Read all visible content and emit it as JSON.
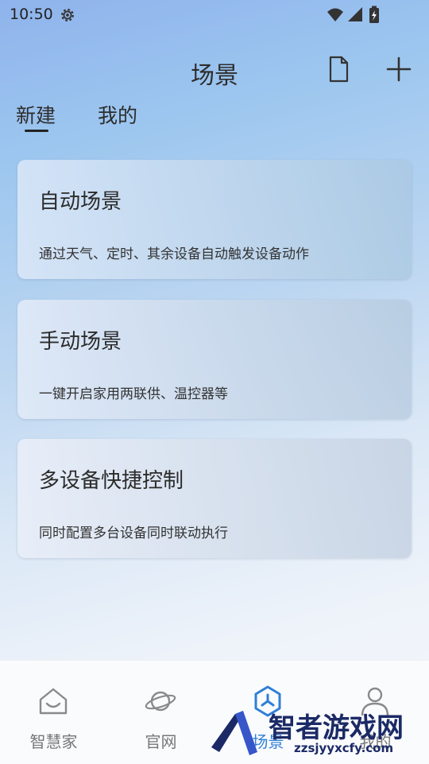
{
  "status_bar": {
    "time": "10:50",
    "icons": [
      "gear-icon",
      "wifi-icon",
      "signal-icon",
      "battery-icon"
    ]
  },
  "header": {
    "title": "场景",
    "actions": [
      "document-icon",
      "plus-icon"
    ]
  },
  "tabs": [
    {
      "label": "新建",
      "active": true
    },
    {
      "label": "我的",
      "active": false
    }
  ],
  "cards": [
    {
      "title": "自动场景",
      "description": "通过天气、定时、其余设备自动触发设备动作"
    },
    {
      "title": "手动场景",
      "description": "一键开启家用两联供、温控器等"
    },
    {
      "title": "多设备快捷控制",
      "description": "同时配置多台设备同时联动执行"
    }
  ],
  "bottom_nav": [
    {
      "label": "智慧家",
      "icon": "home-icon",
      "active": false
    },
    {
      "label": "官网",
      "icon": "planet-icon",
      "active": false
    },
    {
      "label": "场景",
      "icon": "scene-hexagon-icon",
      "active": true
    },
    {
      "label": "我的",
      "icon": "person-icon",
      "active": false
    }
  ],
  "watermark": {
    "text": "智者游戏网",
    "url": "zzsjyyxcfy.com"
  },
  "colors": {
    "accent": "#2f7fd6",
    "text": "#2b2b2b",
    "nav_inactive": "#777777"
  }
}
